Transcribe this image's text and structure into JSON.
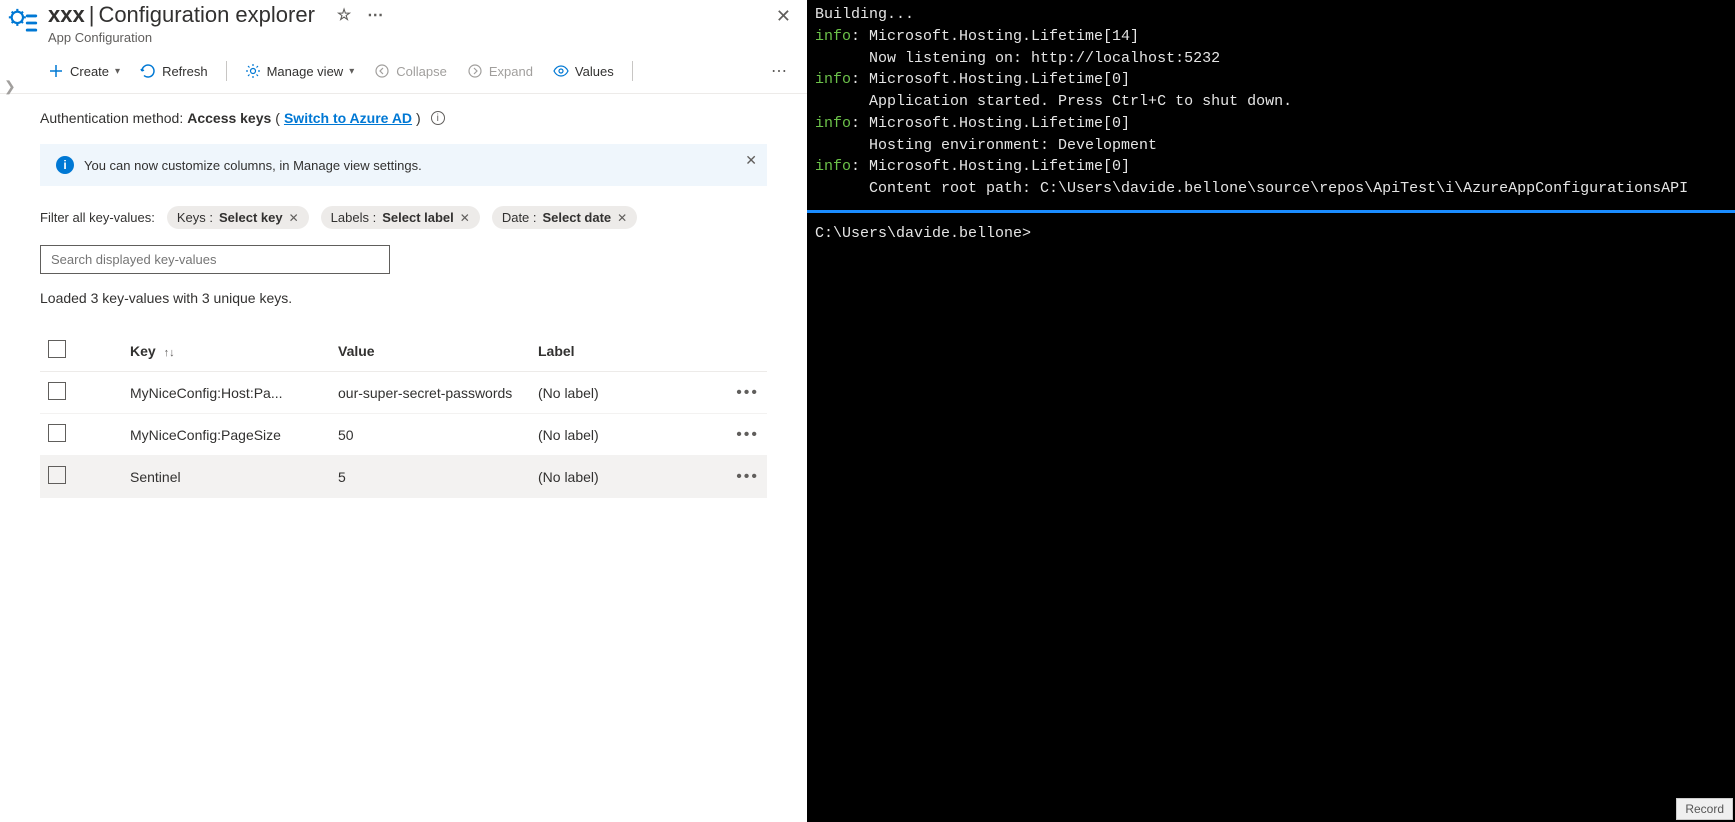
{
  "header": {
    "resource_name": "xxx",
    "page_title": "Configuration explorer",
    "subtitle": "App Configuration"
  },
  "toolbar": {
    "create": "Create",
    "refresh": "Refresh",
    "manage_view": "Manage view",
    "collapse": "Collapse",
    "expand": "Expand",
    "values": "Values"
  },
  "auth": {
    "label": "Authentication method:",
    "value": "Access keys",
    "switch_link": "Switch to Azure AD"
  },
  "info_banner": "You can now customize columns, in Manage view settings.",
  "filters": {
    "label": "Filter all key-values:",
    "keys_k": "Keys :",
    "keys_v": "Select key",
    "labels_k": "Labels :",
    "labels_v": "Select label",
    "date_k": "Date :",
    "date_v": "Select date"
  },
  "search": {
    "placeholder": "Search displayed key-values"
  },
  "loaded_text": "Loaded 3 key-values with 3 unique keys.",
  "table": {
    "headers": {
      "key": "Key",
      "value": "Value",
      "label": "Label"
    },
    "rows": [
      {
        "key": "MyNiceConfig:Host:Pa...",
        "value": "our-super-secret-passwords",
        "label": "(No label)"
      },
      {
        "key": "MyNiceConfig:PageSize",
        "value": "50",
        "label": "(No label)"
      },
      {
        "key": "Sentinel",
        "value": "5",
        "label": "(No label)"
      }
    ]
  },
  "terminal": {
    "lines": [
      {
        "prefix": "",
        "text": "Building..."
      },
      {
        "prefix": "info",
        "text": ": Microsoft.Hosting.Lifetime[14]"
      },
      {
        "prefix": "",
        "text": "      Now listening on: http://localhost:5232"
      },
      {
        "prefix": "info",
        "text": ": Microsoft.Hosting.Lifetime[0]"
      },
      {
        "prefix": "",
        "text": "      Application started. Press Ctrl+C to shut down."
      },
      {
        "prefix": "info",
        "text": ": Microsoft.Hosting.Lifetime[0]"
      },
      {
        "prefix": "",
        "text": "      Hosting environment: Development"
      },
      {
        "prefix": "info",
        "text": ": Microsoft.Hosting.Lifetime[0]"
      },
      {
        "prefix": "",
        "text": "      Content root path: C:\\Users\\davide.bellone\\source\\repos\\ApiTest\\i\\AzureAppConfigurationsAPI"
      }
    ],
    "prompt": "C:\\Users\\davide.bellone>",
    "record": "Record"
  }
}
